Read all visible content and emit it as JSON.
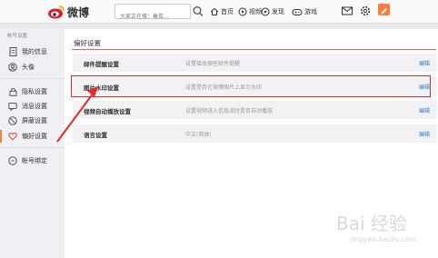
{
  "header": {
    "brand": "微博",
    "search_placeholder": "大家正在搜：秦岚...",
    "nav": [
      {
        "label": "首页",
        "icon": "home-icon"
      },
      {
        "label": "视频",
        "icon": "video-icon"
      },
      {
        "label": "发现",
        "icon": "compass-icon"
      },
      {
        "label": "游戏",
        "icon": "game-icon"
      }
    ]
  },
  "sidebar": {
    "section_title": "帐号设置",
    "items": [
      {
        "label": "我的信息",
        "icon": "document-icon"
      },
      {
        "label": "头像",
        "icon": "user-icon"
      },
      {
        "label": "隐私设置",
        "icon": "lock-icon"
      },
      {
        "label": "消息设置",
        "icon": "message-icon"
      },
      {
        "label": "屏蔽设置",
        "icon": "block-icon"
      },
      {
        "label": "偏好设置",
        "icon": "heart-icon",
        "active": true
      },
      {
        "label": "帐号绑定",
        "icon": "link-icon"
      }
    ]
  },
  "main": {
    "title": "偏好设置",
    "rows": [
      {
        "label": "邮件提醒设置",
        "desc": "设置接收哪些邮件提醒",
        "action": "编辑"
      },
      {
        "label": "图片水印设置",
        "desc": "设置是否在微博图片上显示水印",
        "action": "编辑"
      },
      {
        "label": "视频自动播放设置",
        "desc": "设置视频进入信息流时是否自动播放",
        "action": "编辑"
      },
      {
        "label": "语言设置",
        "desc": "中文(简体)",
        "action": "编辑"
      }
    ]
  },
  "watermark": {
    "text": "Bai 经验",
    "sub": "jingyan.baidu.com"
  },
  "colors": {
    "accent_orange": "#fa7d3c",
    "highlight_red": "#e02b2b",
    "link_blue": "#2c82c5"
  }
}
